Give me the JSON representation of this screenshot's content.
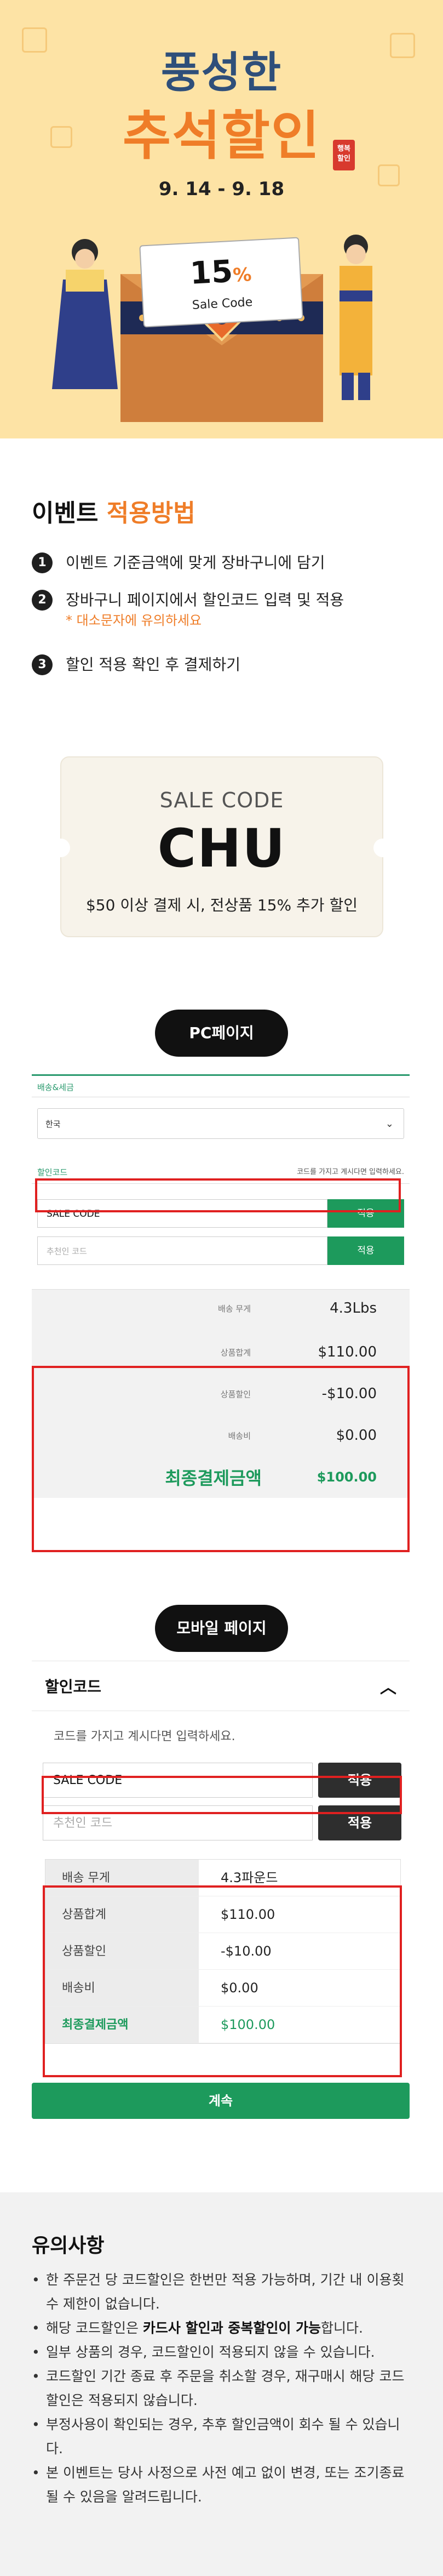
{
  "hero": {
    "title_line1": "풍성한",
    "title_line2": "추석할인",
    "stamp": "행복 할인",
    "date_range": "9. 14 - 9. 18",
    "coupon_percent": "15",
    "coupon_percent_sign": "%",
    "coupon_label": "Sale Code",
    "colors": {
      "background": "#fde3a5",
      "title1": "#2f4f7a",
      "title2": "#ef7d28"
    }
  },
  "howto": {
    "title_prefix": "이벤트",
    "title_accent": "적용방법",
    "steps": [
      {
        "num": "1",
        "text": "이벤트 기준금액에 맞게 장바구니에 담기",
        "note": ""
      },
      {
        "num": "2",
        "text": "장바구니 페이지에서 할인코드 입력 및 적용",
        "note": "* 대소문자에 유의하세요"
      },
      {
        "num": "3",
        "text": "할인 적용 확인 후 결제하기",
        "note": ""
      }
    ]
  },
  "ticket": {
    "label": "SALE CODE",
    "code": "CHU",
    "description": "$50 이상 결제 시, 전상품 15% 추가 할인"
  },
  "pc": {
    "pill": "PC페이지",
    "shipping_tab": "배송&세금",
    "country_value": "한국",
    "discount_tab": "할인코드",
    "discount_hint": "코드를 가지고 계시다면 입력하세요.",
    "code_value": "SALE CODE",
    "apply_label": "적용",
    "ref_placeholder": "추천인 코드",
    "summary": [
      {
        "key": "배송 무게",
        "value": "4.3Lbs"
      },
      {
        "key": "상품합계",
        "value": "$110.00"
      },
      {
        "key": "상품할인",
        "value": "-$10.00"
      },
      {
        "key": "배송비",
        "value": "$0.00"
      },
      {
        "key": "최종결제금액",
        "value": "$100.00"
      }
    ]
  },
  "mobile": {
    "pill": "모바일 페이지",
    "header": "할인코드",
    "hint": "코드를 가지고 계시다면 입력하세요.",
    "code_value": "SALE CODE",
    "apply_label": "적용",
    "ref_placeholder": "추천인 코드",
    "summary": [
      {
        "key": "배송 무게",
        "value": "4.3파운드"
      },
      {
        "key": "상품합계",
        "value": "$110.00"
      },
      {
        "key": "상품할인",
        "value": "-$10.00"
      },
      {
        "key": "배송비",
        "value": "$0.00"
      },
      {
        "key": "최종결제금액",
        "value": "$100.00"
      }
    ],
    "continue_label": "계속"
  },
  "notice": {
    "title": "유의사항",
    "items": [
      {
        "a": "한 주문건 당 코드할인은 한번만 적용 가능하며, 기간 내 이용횟수 제한이 없습니다.",
        "b": "",
        "c": ""
      },
      {
        "a": "해당 코드할인은 ",
        "b": "카드사 할인과 중복할인이 가능",
        "c": "합니다."
      },
      {
        "a": "일부 상품의 경우, 코드할인이 적용되지 않을 수 있습니다.",
        "b": "",
        "c": ""
      },
      {
        "a": "코드할인 기간 종료 후 주문을 취소할 경우, 재구매시 해당 코드할인은 적용되지 않습니다.",
        "b": "",
        "c": ""
      },
      {
        "a": "부정사용이 확인되는 경우, 추후 할인금액이 회수 될 수 있습니다.",
        "b": "",
        "c": ""
      },
      {
        "a": "본 이벤트는 당사 사정으로 사전 예고 없이 변경, 또는 조기종료 될 수 있음을 알려드립니다.",
        "b": "",
        "c": ""
      }
    ]
  }
}
